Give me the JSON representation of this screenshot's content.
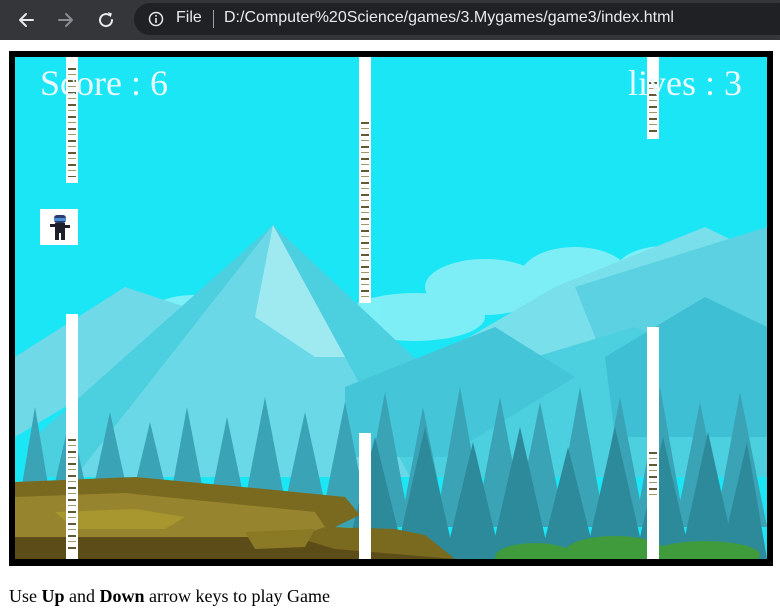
{
  "browser": {
    "file_label": "File",
    "url": "D:/Computer%20Science/games/3.Mygames/game3/index.html"
  },
  "game": {
    "score_text": "Score : 6",
    "lives_text": "lives : 3"
  },
  "instructions": {
    "prefix": "Use",
    "key_up": "Up",
    "and": "and",
    "key_down": "Down",
    "suffix": "arrow keys to play Game"
  },
  "colors": {
    "sky": "#1ae6f6",
    "chrome": "#35363a",
    "omnibox": "#202124"
  }
}
